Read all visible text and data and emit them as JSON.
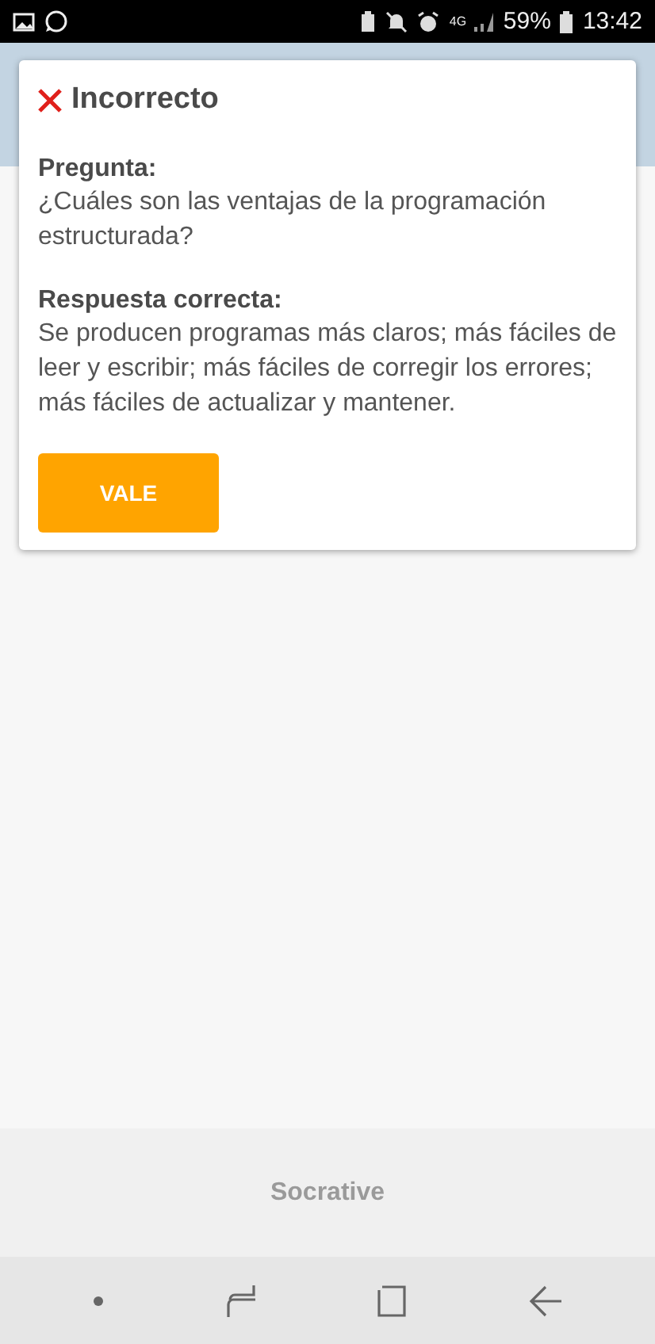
{
  "status_bar": {
    "network": "4G",
    "battery": "59%",
    "time": "13:42"
  },
  "dialog": {
    "title": "Incorrecto",
    "sections": [
      {
        "heading": "Pregunta:",
        "text": "¿Cuáles son las ventajas de la programación estructurada?"
      },
      {
        "heading": "Respuesta correcta:",
        "text": "Se producen programas más claros; más fáciles de leer y escribir; más fáciles de corregir los errores; más fáciles de actualizar y mantener."
      }
    ],
    "button": "VALE"
  },
  "footer": {
    "brand": "Socrative"
  }
}
